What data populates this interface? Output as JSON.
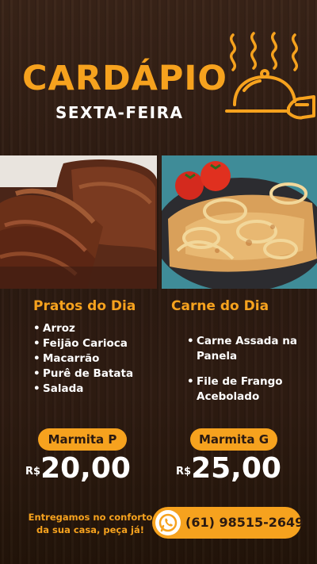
{
  "header": {
    "title": "CARDÁPIO",
    "subtitle": "SEXTA-FEIRA"
  },
  "left_column": {
    "title": "Pratos do Dia",
    "items": [
      "Arroz",
      "Feijão Carioca",
      "Macarrão",
      "Purê de Batata",
      "Salada"
    ],
    "size_label": "Marmita P",
    "currency": "R$",
    "price": "20,00"
  },
  "right_column": {
    "title": "Carne do Dia",
    "items": [
      "Carne Assada na Panela",
      "File de Frango Acebolado"
    ],
    "size_label": "Marmita G",
    "currency": "R$",
    "price": "25,00"
  },
  "footer": {
    "tagline_line1": "Entregamos no conforto",
    "tagline_line2": "da sua casa, peça já!",
    "phone": "(61) 98515-2649"
  },
  "icons": {
    "cloche": "cloche-hand-icon",
    "phone": "whatsapp-phone-icon"
  },
  "colors": {
    "accent": "#f6a21e",
    "background": "#2a1a12",
    "text": "#ffffff"
  }
}
